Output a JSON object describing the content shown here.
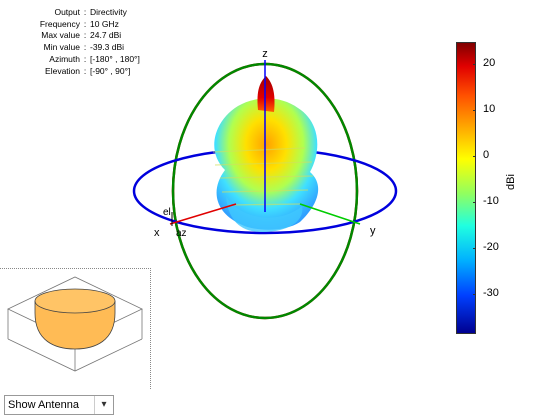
{
  "info": {
    "rows": [
      {
        "label": "Output",
        "value": "Directivity"
      },
      {
        "label": "Frequency",
        "value": "10 GHz"
      },
      {
        "label": "Max value",
        "value": "24.7 dBi"
      },
      {
        "label": "Min value",
        "value": "-39.3 dBi"
      },
      {
        "label": "Azimuth",
        "value": "[-180° , 180°]"
      },
      {
        "label": "Elevation",
        "value": "[-90° , 90°]"
      }
    ]
  },
  "plot": {
    "axis_labels": {
      "z": "z",
      "x": "x",
      "y": "y",
      "el": "el",
      "az": "az"
    }
  },
  "colorbar": {
    "unit": "dBi",
    "ticks": [
      "20",
      "10",
      "0",
      "-10",
      "-20",
      "-30"
    ],
    "range": [
      -39.3,
      24.7
    ]
  },
  "control": {
    "dropdown_value": "Show Antenna"
  },
  "colors": {
    "x_axis": "#e00000",
    "y_axis": "#00cc00",
    "z_axis": "#0000ff",
    "azimuth_ring": "#0000dd",
    "elevation_ring_1": "#dd0000",
    "elevation_ring_2": "#008800",
    "antenna": "#ffbb55"
  }
}
